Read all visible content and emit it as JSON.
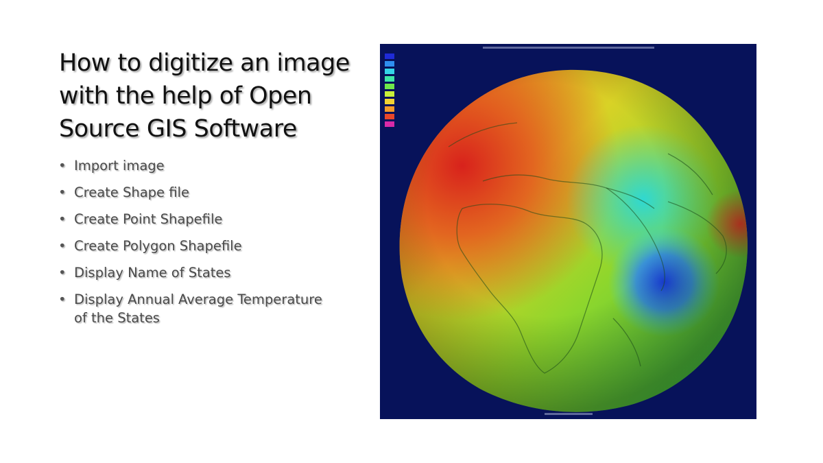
{
  "slide": {
    "title": "How to digitize an image with the help of Open Source GIS Software",
    "bullets": [
      "Import image",
      "Create Shape file",
      "Create Point Shapefile",
      "Create Polygon Shapefile",
      "Display Name of States",
      "Display Annual Average Temperature of the States"
    ],
    "bullet_glyph": "•"
  },
  "figure": {
    "icon": "geoid-globe-image",
    "background_color": "#07125a",
    "legend_colors": [
      "#1f2bd8",
      "#2f8ef0",
      "#34d4e8",
      "#3fe6a6",
      "#6fe84a",
      "#c8ef3a",
      "#f2d233",
      "#f39a2a",
      "#e8462a",
      "#d82aa8"
    ]
  }
}
